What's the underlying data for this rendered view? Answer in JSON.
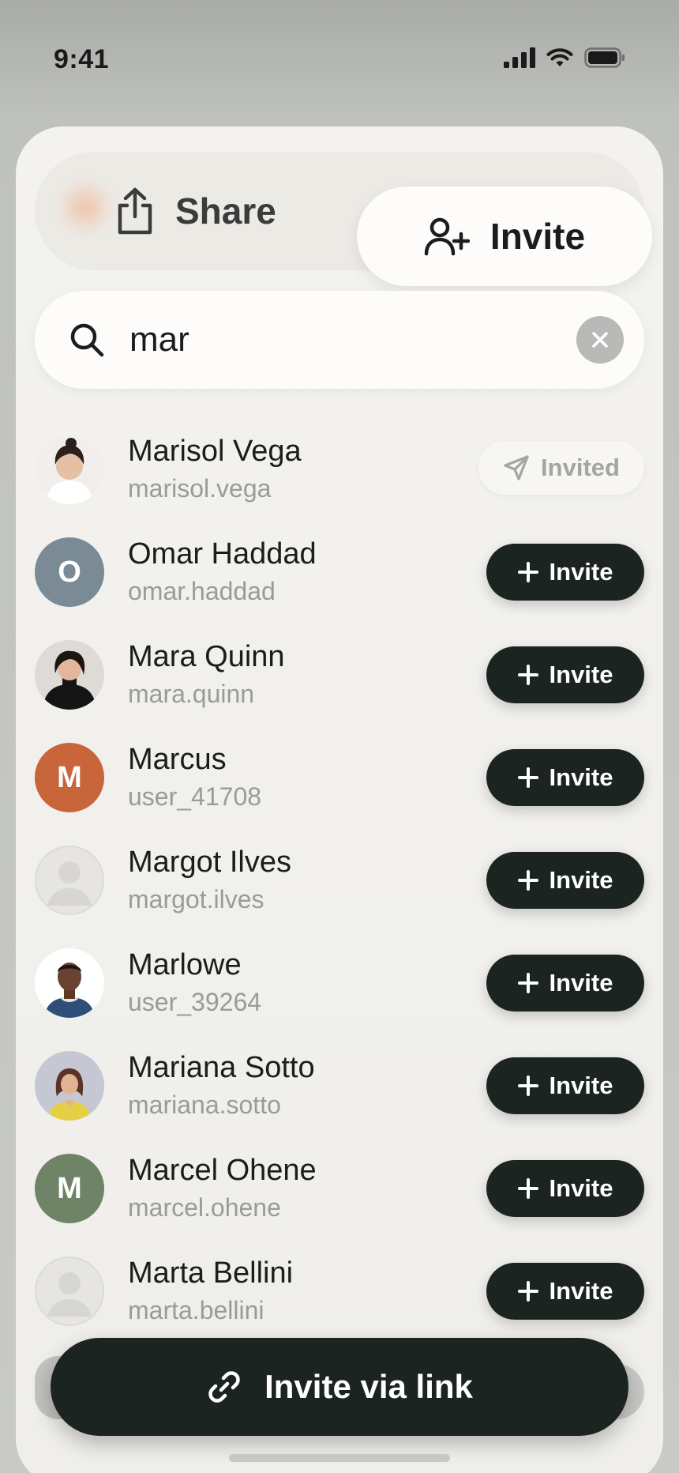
{
  "status_bar": {
    "time": "9:41"
  },
  "segmented": {
    "share_label": "Share",
    "invite_label": "Invite",
    "active": "Invite"
  },
  "search": {
    "value": "mar",
    "placeholder": ""
  },
  "contacts": [
    {
      "name": "Marisol Vega",
      "handle": "marisol.vega",
      "avatar": "photo",
      "state": "Invited"
    },
    {
      "name": "Omar Haddad",
      "handle": "omar.haddad",
      "avatar": "initial",
      "initial": "O",
      "color": "#7a8b95",
      "state": "Invite"
    },
    {
      "name": "Mara Quinn",
      "handle": "mara.quinn",
      "avatar": "photo",
      "state": "Invite"
    },
    {
      "name": "Marcus",
      "handle": "user_41708",
      "avatar": "initial",
      "initial": "M",
      "color": "#c8653a",
      "state": "Invite"
    },
    {
      "name": "Margot Ilves",
      "handle": "margot.ilves",
      "avatar": "placeholder",
      "state": "Invite"
    },
    {
      "name": "Marlowe",
      "handle": "user_39264",
      "avatar": "photo",
      "state": "Invite"
    },
    {
      "name": "Mariana Sotto",
      "handle": "mariana.sotto",
      "avatar": "photo",
      "state": "Invite"
    },
    {
      "name": "Marcel Ohene",
      "handle": "marcel.ohene",
      "avatar": "initial",
      "initial": "M",
      "color": "#6f8366",
      "state": "Invite"
    },
    {
      "name": "Marta Bellini",
      "handle": "marta.bellini",
      "avatar": "placeholder",
      "state": "Invite"
    }
  ],
  "buttons": {
    "invite": "Invite",
    "invited": "Invited",
    "invite_via_link": "Invite via link"
  },
  "colors": {
    "button_dark": "#1c2421",
    "sheet_bg": "#efeeea",
    "muted_text": "#9a9b98"
  }
}
